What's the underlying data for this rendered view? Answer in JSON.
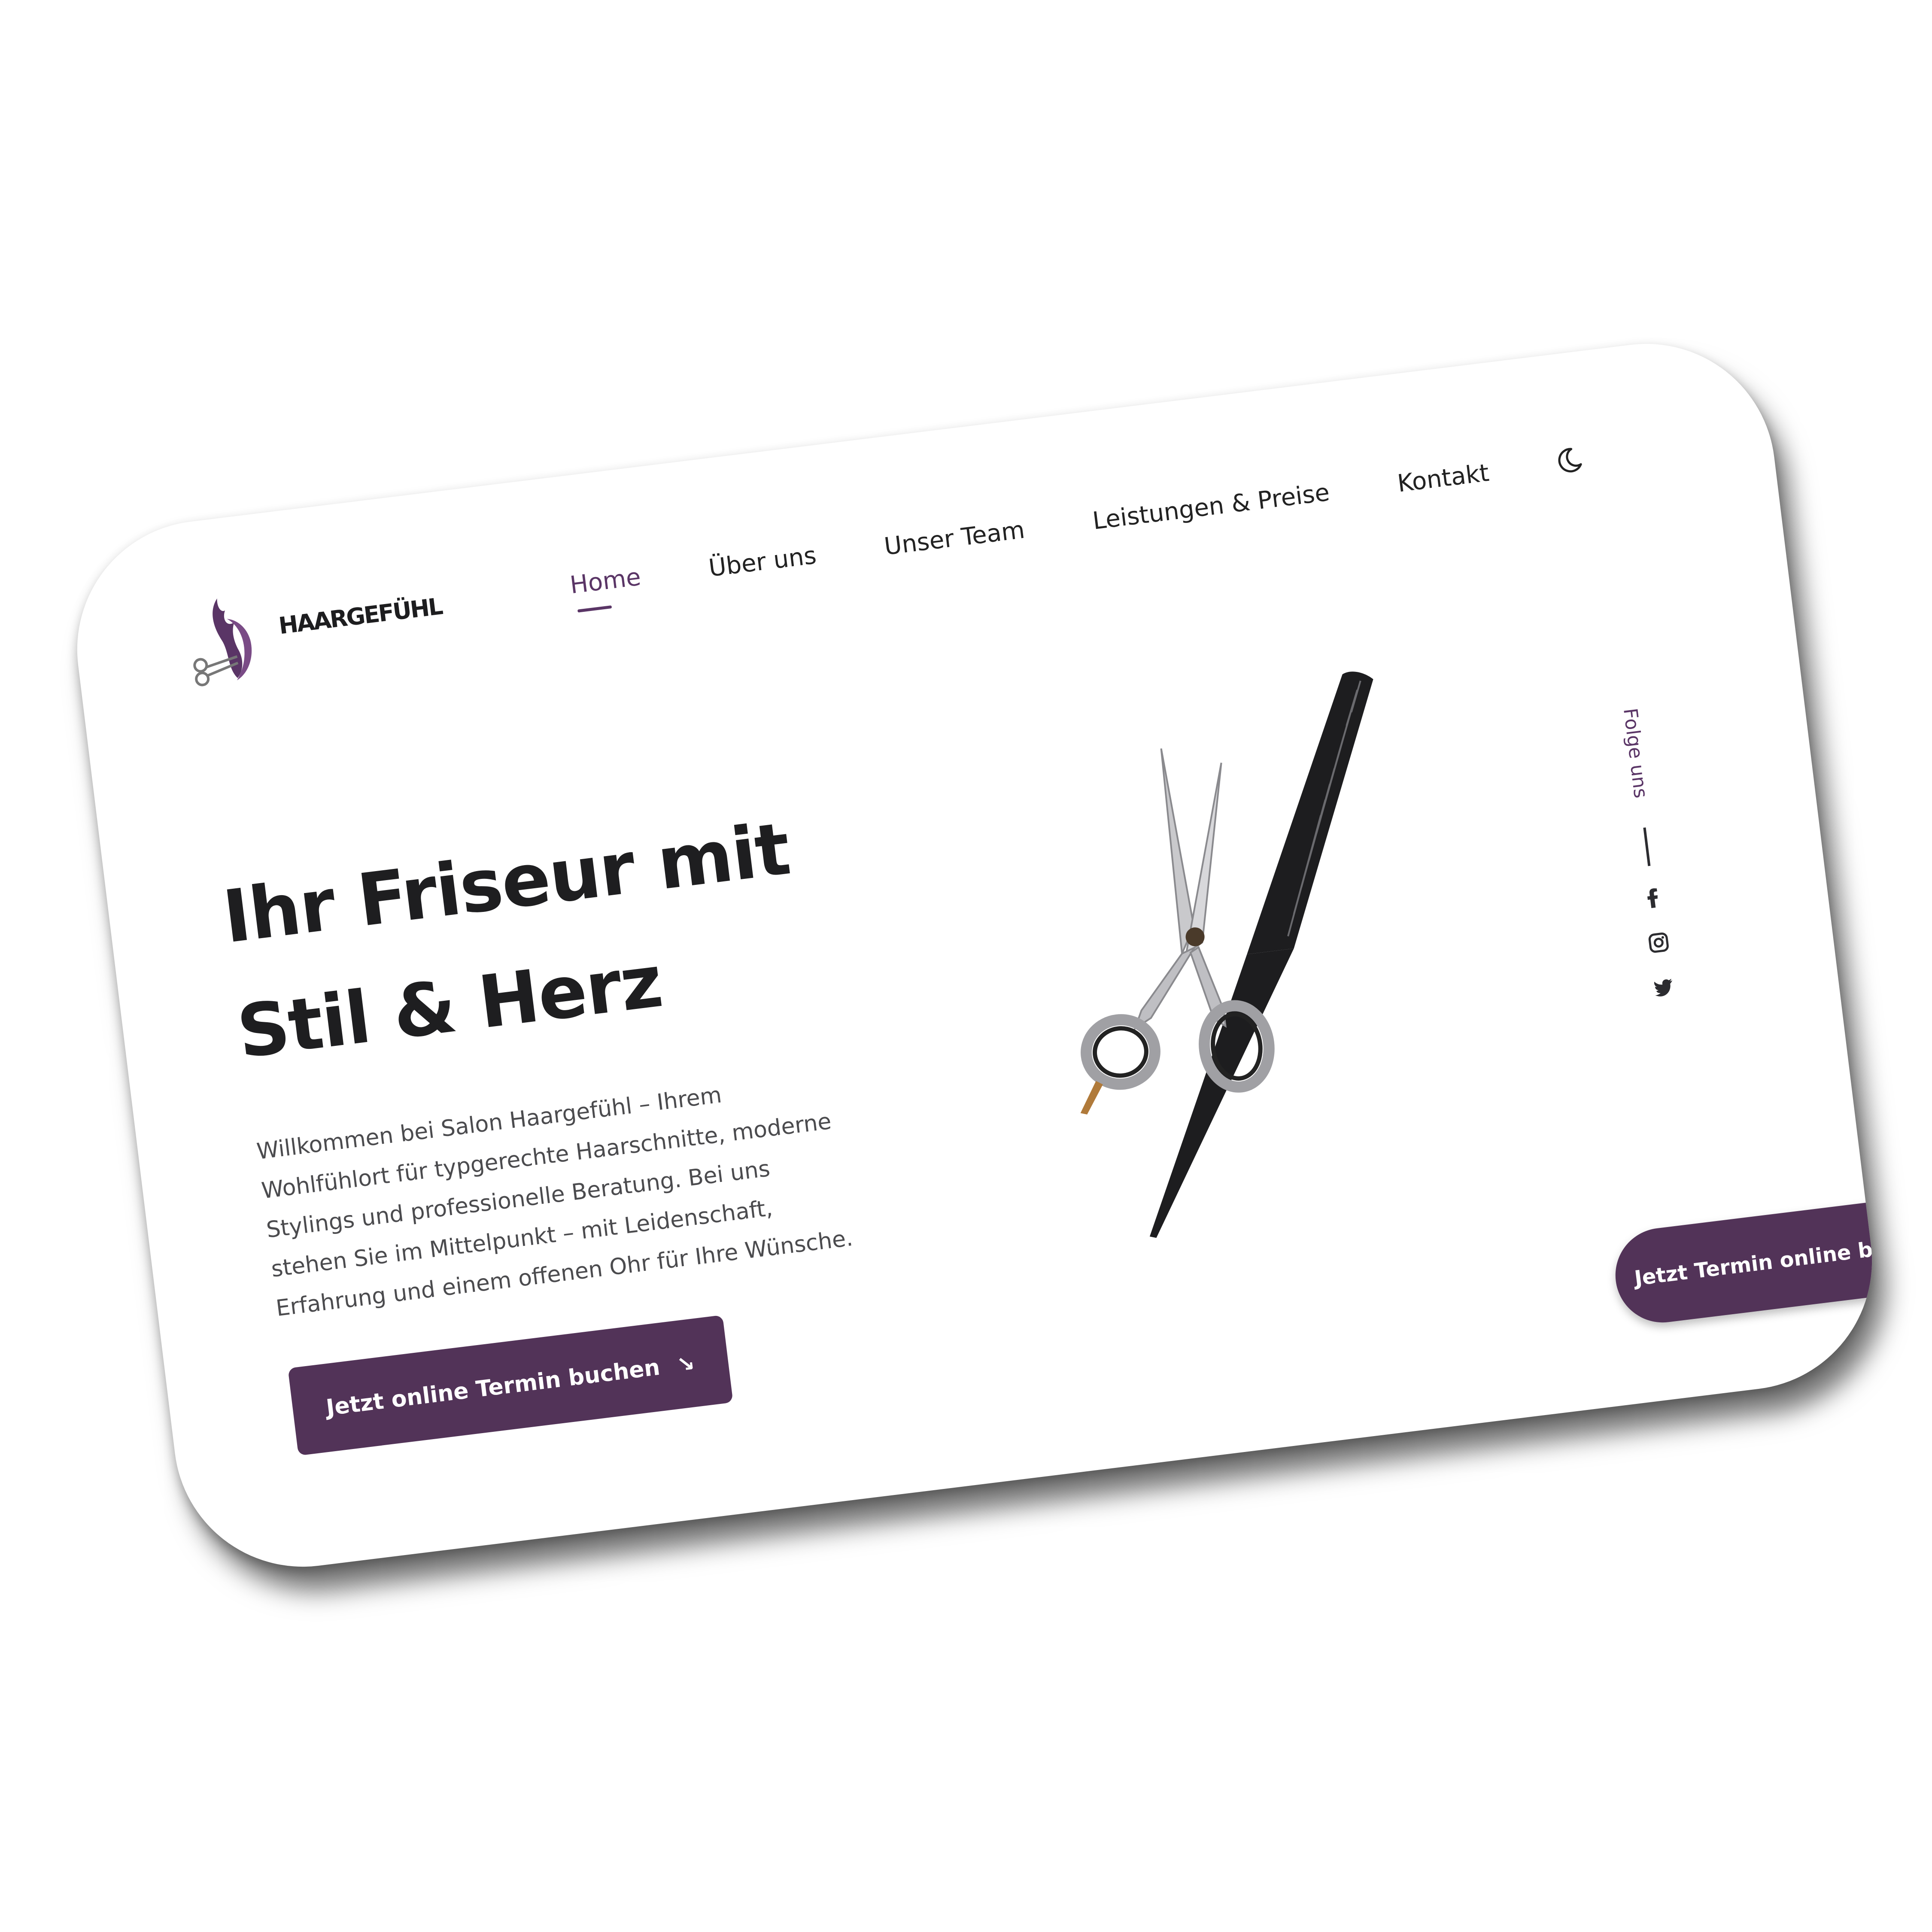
{
  "brand": {
    "name": "HAARGEFÜHL",
    "logo_icon": "hair-scissors-logo-icon"
  },
  "nav": {
    "items": [
      {
        "label": "Home",
        "active": true
      },
      {
        "label": "Über uns",
        "active": false
      },
      {
        "label": "Unser Team",
        "active": false
      },
      {
        "label": "Leistungen & Preise",
        "active": false
      },
      {
        "label": "Kontakt",
        "active": false
      }
    ],
    "theme_toggle_icon": "moon-icon"
  },
  "hero": {
    "title_line1": "Ihr Friseur mit",
    "title_line2": "Stil & Herz",
    "text": "Willkommen bei Salon Haargefühl – Ihrem Wohlfühlort für typgerechte Haarschnitte, moderne Stylings und professionelle Beratung. Bei uns stehen Sie im Mittelpunkt – mit Leidenschaft, Erfahrung und einem offenen Ohr für Ihre Wünsche.",
    "cta_label": "Jetzt online Termin buchen",
    "cta_icon": "arrow-down-right-icon"
  },
  "social": {
    "label": "Folge uns",
    "icons": [
      "facebook-icon",
      "instagram-icon",
      "twitter-icon"
    ]
  },
  "floating_cta": {
    "label": "Jetzt Termin online buchen"
  },
  "colors": {
    "accent": "#523358",
    "text_dark": "#1e1e20",
    "text_body": "#4b4b4e",
    "background": "#ffffff"
  }
}
